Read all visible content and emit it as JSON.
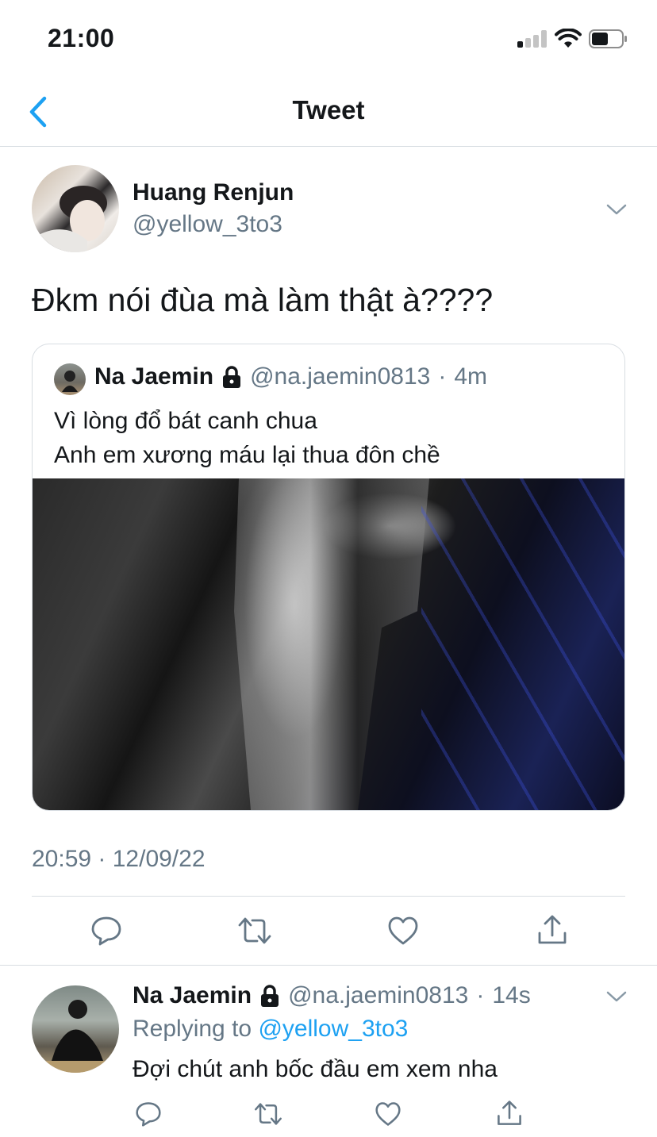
{
  "status_bar": {
    "time": "21:00"
  },
  "nav": {
    "title": "Tweet"
  },
  "tweet": {
    "name": "Huang Renjun",
    "handle": "@yellow_3to3",
    "text": "Đkm nói đùa mà làm thật à????",
    "timestamp": "20:59 · 12/09/22",
    "quote": {
      "name": "Na Jaemin",
      "handle": "@na.jaemin0813",
      "sep": "·",
      "time": "4m",
      "line1": "Vì lòng đổ bát canh chua",
      "line2": "Anh em xương máu lại thua đôn chề"
    }
  },
  "reply": {
    "name": "Na Jaemin",
    "handle": "@na.jaemin0813",
    "sep": "·",
    "time": "14s",
    "replying_prefix": "Replying to",
    "replying_handle": "@yellow_3to3",
    "text": "Đợi chút anh bốc đầu em xem nha"
  },
  "colors": {
    "accent": "#1da1f2",
    "muted": "#657786",
    "text": "#14171a"
  },
  "icons": [
    "back-chevron-icon",
    "chevron-down-icon",
    "lock-icon",
    "reply-icon",
    "retweet-icon",
    "like-icon",
    "share-icon"
  ]
}
